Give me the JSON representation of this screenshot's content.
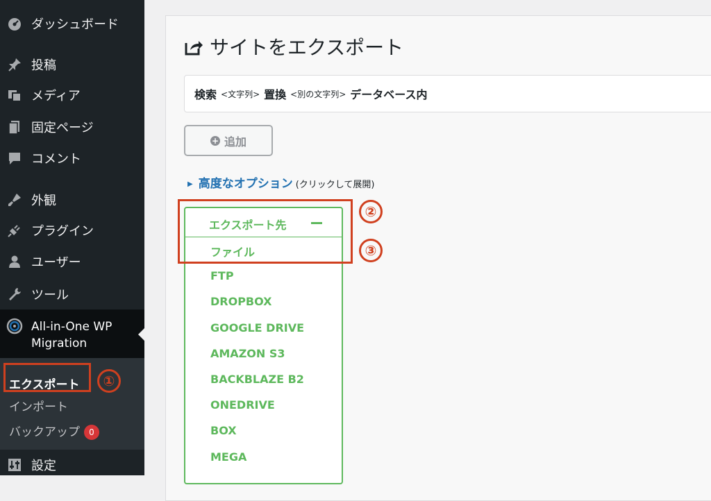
{
  "sidebar": {
    "items": [
      {
        "label": "ダッシュボード",
        "icon": "dashboard-icon"
      },
      {
        "label": "投稿",
        "icon": "pin-icon"
      },
      {
        "label": "メディア",
        "icon": "media-icon"
      },
      {
        "label": "固定ページ",
        "icon": "page-icon"
      },
      {
        "label": "コメント",
        "icon": "comment-icon"
      },
      {
        "label": "外観",
        "icon": "brush-icon"
      },
      {
        "label": "プラグイン",
        "icon": "plugin-icon"
      },
      {
        "label": "ユーザー",
        "icon": "user-icon"
      },
      {
        "label": "ツール",
        "icon": "wrench-icon"
      }
    ],
    "plugin": {
      "line1": "All-in-One WP",
      "line2": "Migration",
      "icon": "migration-icon"
    },
    "submenu": {
      "export": "エクスポート",
      "import": "インポート",
      "backup": "バックアップ",
      "backup_count": "0"
    },
    "settings": {
      "label": "設定",
      "icon": "settings-icon"
    }
  },
  "main": {
    "title": "サイトをエクスポート",
    "search": {
      "search_label": "検索",
      "search_hint": "<文字列>",
      "replace_label": "置換",
      "replace_hint": "<別の文字列>",
      "db_label": "データベース内"
    },
    "add_button": "追加",
    "advanced": {
      "link": "高度なオプション",
      "hint": "(クリックして展開)"
    },
    "export_to": {
      "header": "エクスポート先",
      "options": [
        "ファイル",
        "FTP",
        "DROPBOX",
        "GOOGLE DRIVE",
        "AMAZON S3",
        "BACKBLAZE B2",
        "ONEDRIVE",
        "BOX",
        "MEGA"
      ]
    }
  },
  "annotations": [
    "①",
    "②",
    "③"
  ],
  "colors": {
    "sidebar_bg": "#1d2327",
    "accent_green": "#5db85c",
    "link_blue": "#2271b1",
    "annotation_red": "#d0401f",
    "badge_red": "#d63638"
  }
}
